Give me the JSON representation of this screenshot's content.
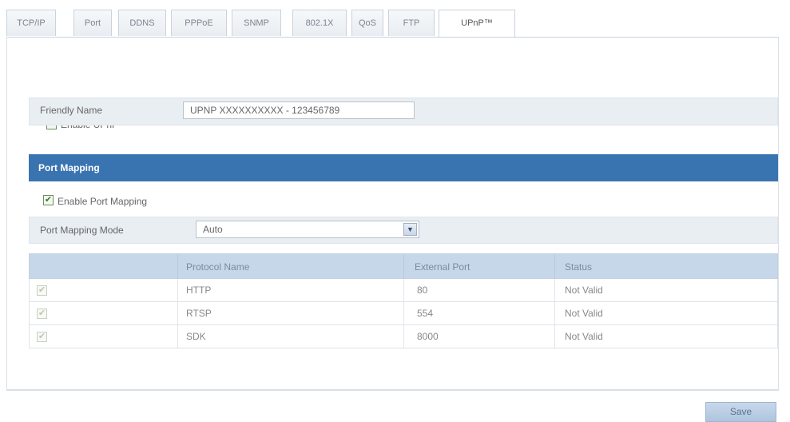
{
  "tabs": [
    {
      "label": "TCP/IP",
      "active": false
    },
    {
      "label": "Port",
      "active": false
    },
    {
      "label": "DDNS",
      "active": false
    },
    {
      "label": "PPPoE",
      "active": false
    },
    {
      "label": "SNMP",
      "active": false
    },
    {
      "label": "802.1X",
      "active": false
    },
    {
      "label": "QoS",
      "active": false
    },
    {
      "label": "FTP",
      "active": false
    },
    {
      "label": "UPnP™",
      "active": true
    }
  ],
  "upnp": {
    "enable_label": "Enable UPnP™",
    "enable_checked": true,
    "friendly_name_label": "Friendly Name",
    "friendly_name_value": "UPNP XXXXXXXXXX - 123456789"
  },
  "port_mapping": {
    "section_title": "Port Mapping",
    "enable_label": "Enable Port Mapping",
    "enable_checked": true,
    "mode_label": "Port Mapping Mode",
    "mode_value": "Auto",
    "table": {
      "headers": [
        "",
        "Protocol Name",
        "External Port",
        "Status"
      ],
      "rows": [
        {
          "protocol": "HTTP",
          "port": "80",
          "status": "Not Valid"
        },
        {
          "protocol": "RTSP",
          "port": "554",
          "status": "Not Valid"
        },
        {
          "protocol": "SDK",
          "port": "8000",
          "status": "Not Valid"
        }
      ]
    }
  },
  "save_label": "Save",
  "icons": {
    "checkmark": "checkmark-icon",
    "dropdown": "chevron-down-icon"
  }
}
